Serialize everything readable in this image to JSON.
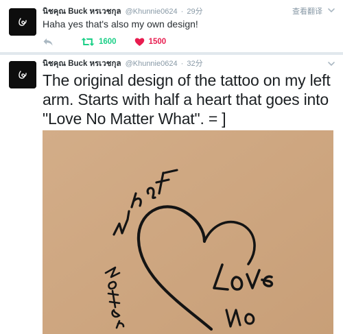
{
  "tweets": [
    {
      "fullname": "นิชคุณ Buck หรเวชกุล",
      "username": "@Khunnie0624",
      "separator": "·",
      "time": "29分",
      "translate_label": "查看翻译",
      "text": "Haha yes that's also my own design!",
      "actions": {
        "reply_icon": "reply-icon",
        "retweet_icon": "retweet-icon",
        "retweet_count": "1600",
        "like_icon": "heart-icon",
        "like_count": "1500"
      }
    },
    {
      "fullname": "นิชคุณ Buck หรเวชกุล",
      "username": "@Khunnie0624",
      "separator": "·",
      "time": "32分",
      "text": "The original design of the tattoo on my left arm. Starts with half a heart that goes into \"Love No Matter What\". = ]",
      "media": {
        "kind": "tattoo-design-photo",
        "tattoo_text_words": [
          "Love",
          "No",
          "Matter",
          "What"
        ]
      }
    }
  ],
  "colors": {
    "retweet_accent": "#19cf86",
    "like_accent": "#e81c4f",
    "meta_gray": "#8899a6",
    "media_paper": "#cfa782"
  }
}
